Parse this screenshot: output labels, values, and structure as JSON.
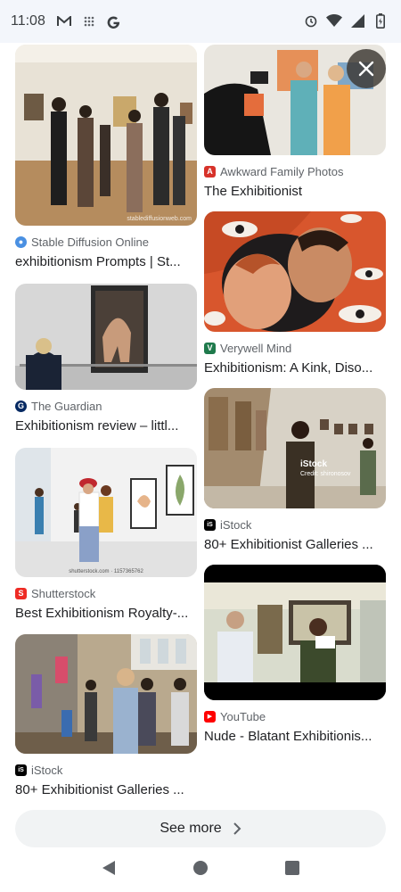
{
  "status_bar": {
    "time": "11:08",
    "left_icons": [
      "gmail-icon",
      "grid-icon",
      "google-g-icon"
    ],
    "right_icons": [
      "alarm-icon",
      "wifi-icon",
      "signal-icon",
      "battery-icon"
    ]
  },
  "results": {
    "left": [
      {
        "source": "Stable Diffusion Online",
        "title": "exhibitionism Prompts | St...",
        "favicon_color": "#4a90e2",
        "favicon_glyph": "●",
        "thumb_caption": "stablediffusionweb.com"
      },
      {
        "source": "The Guardian",
        "title": "Exhibitionism review – littl...",
        "favicon_color": "#052962",
        "favicon_glyph": "G"
      },
      {
        "source": "Shutterstock",
        "title": "Best Exhibitionism Royalty-...",
        "favicon_color": "#ee2b24",
        "favicon_glyph": "S",
        "thumb_caption": "shutterstock.com · 1157365762"
      },
      {
        "source": "iStock",
        "title": "80+ Exhibitionist Galleries ...",
        "favicon_color": "#000000",
        "favicon_glyph": "iS"
      }
    ],
    "right": [
      {
        "source": "Awkward Family Photos",
        "title": "The Exhibitionist",
        "favicon_color": "#d7322a",
        "favicon_glyph": "A"
      },
      {
        "source": "Verywell Mind",
        "title": "Exhibitionism: A Kink, Diso...",
        "favicon_color": "#1f7a4c",
        "favicon_glyph": "V"
      },
      {
        "source": "iStock",
        "title": "80+ Exhibitionist Galleries ...",
        "favicon_color": "#000000",
        "favicon_glyph": "iS",
        "thumb_caption": "iStock",
        "thumb_credit": "Credit: shironosov"
      },
      {
        "source": "YouTube",
        "title": "Nude - Blatant Exhibitionis...",
        "favicon_color": "#ff0000",
        "favicon_glyph": "▶"
      }
    ]
  },
  "see_more": {
    "label": "See more",
    "icon": "chevron-right-icon"
  },
  "close_button": {
    "icon": "close-icon"
  },
  "nav_bar": {
    "icons": [
      "back-icon",
      "home-icon",
      "recents-icon"
    ]
  }
}
